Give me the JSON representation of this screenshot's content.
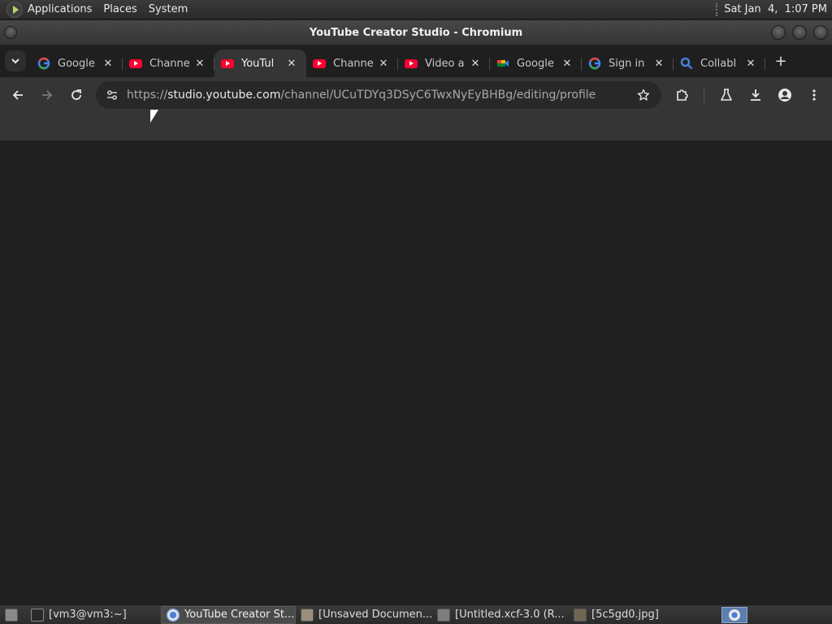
{
  "top_panel": {
    "menus": [
      "Applications",
      "Places",
      "System"
    ],
    "clock": "Sat Jan  4,  1:07 PM"
  },
  "window": {
    "title": "YouTube Creator Studio - Chromium"
  },
  "tabs": [
    {
      "label": "Google",
      "favicon": "google-icon"
    },
    {
      "label": "Channe",
      "favicon": "youtube-icon"
    },
    {
      "label": "YouTul",
      "favicon": "youtube-icon",
      "active": true
    },
    {
      "label": "Channe",
      "favicon": "youtube-icon"
    },
    {
      "label": "Video a",
      "favicon": "youtube-icon"
    },
    {
      "label": "Google",
      "favicon": "google-meet-icon"
    },
    {
      "label": "Sign in",
      "favicon": "google-icon"
    },
    {
      "label": "Collabl",
      "favicon": "search-icon"
    }
  ],
  "omnibox": {
    "scheme": "https://",
    "host": "studio.youtube.com",
    "path": "/channel/UCuTDYq3DSyC6TwxNyEyBHBg/editing/profile"
  },
  "taskbar": {
    "items": [
      {
        "label": "[vm3@vm3:~]",
        "icon": "terminal-icon"
      },
      {
        "label": "YouTube Creator St...",
        "icon": "chromium-icon",
        "active": true
      },
      {
        "label": "[Unsaved Documen...",
        "icon": "text-editor-icon"
      },
      {
        "label": "[Untitled.xcf-3.0 (R...",
        "icon": "gimp-icon"
      },
      {
        "label": "[5c5gd0.jpg]",
        "icon": "image-viewer-icon"
      }
    ]
  },
  "colors": {
    "accent_blue": "#4a7fd6",
    "youtube_red": "#ff0033"
  }
}
